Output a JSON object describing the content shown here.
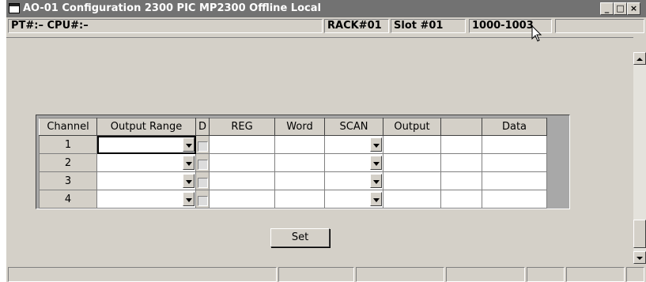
{
  "window": {
    "title": "AO-01 Configuration   2300 PIC MP2300   Offline Local",
    "minimize": "_",
    "maximize": "□",
    "close": "×"
  },
  "info": {
    "pt_cpu": "PT#:– CPU#:–",
    "rack": "RACK#01",
    "slot": "Slot #01",
    "range": "1000-1003",
    "extra": ""
  },
  "grid": {
    "headers": [
      "Channel",
      "Output Range",
      "D",
      "REG",
      "Word",
      "SCAN",
      "Output",
      "",
      "Data"
    ],
    "rows": [
      {
        "channel": "1"
      },
      {
        "channel": "2"
      },
      {
        "channel": "3"
      },
      {
        "channel": "4"
      }
    ]
  },
  "buttons": {
    "set": "Set"
  },
  "colors": {
    "titlebar": "#727272",
    "face": "#d4d0c8",
    "grid_bg": "#a8a8a8"
  }
}
